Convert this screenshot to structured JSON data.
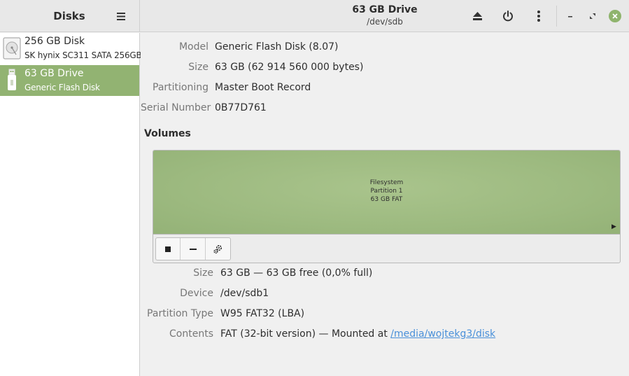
{
  "app": {
    "title": "Disks",
    "menu_icon": "hamburger-menu-icon"
  },
  "header": {
    "drive_title": "63 GB Drive",
    "drive_path": "/dev/sdb",
    "eject_icon": "eject-icon",
    "power_icon": "power-off-icon",
    "more_icon": "more-vertical-icon",
    "minimize_glyph": "–",
    "restore_glyph": "⤡",
    "close_glyph": "✕"
  },
  "sidebar": {
    "items": [
      {
        "name": "256 GB Disk",
        "sub": "SK hynix SC311 SATA 256GB",
        "icon": "hard-disk-icon",
        "selected": false
      },
      {
        "name": "63 GB Drive",
        "sub": "Generic Flash Disk",
        "icon": "usb-drive-icon",
        "selected": true
      }
    ]
  },
  "drive": {
    "model_label": "Model",
    "model_value": "Generic Flash Disk (8.07)",
    "size_label": "Size",
    "size_value": "63 GB (62 914 560 000 bytes)",
    "partitioning_label": "Partitioning",
    "partitioning_value": "Master Boot Record",
    "serial_label": "Serial Number",
    "serial_value": "0B77D761"
  },
  "volumes": {
    "title": "Volumes",
    "partition_line1": "Filesystem",
    "partition_line2": "Partition 1",
    "partition_line3": "63 GB FAT",
    "toolbar": {
      "stop_icon": "stop-icon",
      "remove_icon": "minus-icon",
      "settings_icon": "gears-icon"
    }
  },
  "volume_details": {
    "size_label": "Size",
    "size_value": "63 GB — 63 GB free (0,0% full)",
    "device_label": "Device",
    "device_value": "/dev/sdb1",
    "ptype_label": "Partition Type",
    "ptype_value": "W95 FAT32 (LBA)",
    "contents_label": "Contents",
    "contents_prefix": "FAT (32-bit version) — Mounted at ",
    "contents_link": "/media/wojtekg3/disk"
  },
  "colors": {
    "selected": "#92b372",
    "partition": "#9dba80",
    "link": "#4a90d9",
    "close_button": "#8fb46d"
  }
}
